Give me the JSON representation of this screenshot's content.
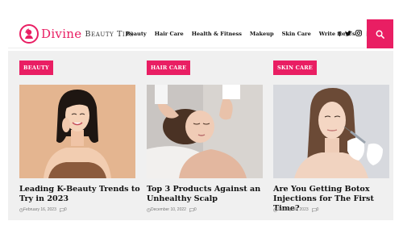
{
  "brand": {
    "name": "Divine",
    "tagline": "Beauty Tips",
    "accent": "#e91e63"
  },
  "nav": {
    "items": [
      "Beauty",
      "Hair Care",
      "Health & Fitness",
      "Makeup",
      "Skin Care",
      "Write for Us"
    ]
  },
  "social": [
    "facebook-icon",
    "twitter-icon",
    "instagram-icon",
    "linkedin-icon"
  ],
  "search": {
    "icon": "search-icon"
  },
  "posts": [
    {
      "category": "BEAUTY",
      "title": "Leading K-Beauty Trends to Try in 2023",
      "date": "February 16, 2023",
      "comments": "0"
    },
    {
      "category": "HAIR CARE",
      "title": "Top 3 Products Against an Unhealthy Scalp",
      "date": "December 10, 2022",
      "comments": "0"
    },
    {
      "category": "SKIN CARE",
      "title": "Are You Getting Botox Injections for The First Time?",
      "date": "January 30, 2023",
      "comments": "0"
    }
  ]
}
